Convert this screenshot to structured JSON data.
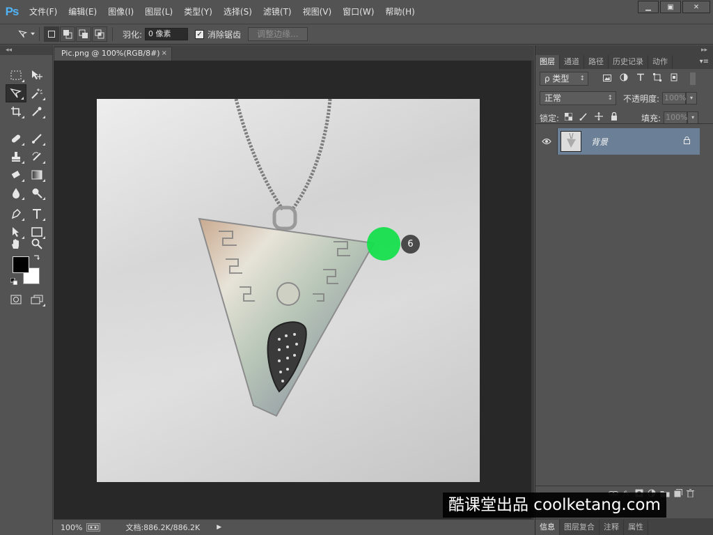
{
  "app": {
    "logo": "Ps",
    "menus": [
      "文件(F)",
      "编辑(E)",
      "图像(I)",
      "图层(L)",
      "类型(Y)",
      "选择(S)",
      "滤镜(T)",
      "视图(V)",
      "窗口(W)",
      "帮助(H)"
    ],
    "window_controls": {
      "minimize": "▁",
      "maximize": "▣",
      "close": "✕"
    }
  },
  "options": {
    "feather_label": "羽化:",
    "feather_value": "0 像素",
    "antialias_checked": "✓",
    "antialias_label": "消除锯齿",
    "refine_edge_label": "调整边缘..."
  },
  "toolbox": {
    "collapse": "◂◂"
  },
  "document": {
    "tab_title": "Pic.png @ 100%(RGB/8#)",
    "tab_close": "×"
  },
  "status": {
    "zoom": "100%",
    "doc_size": "文档:886.2K/886.2K",
    "arrow": "▶"
  },
  "panels": {
    "collapse": "▸▸",
    "top_tabs": [
      "图层",
      "通道",
      "路径",
      "历史记录",
      "动作"
    ],
    "menu_icon": "▾≡",
    "filter_type": "ρ 类型",
    "blend_mode": "正常",
    "opacity_label": "不透明度:",
    "opacity_value": "100%",
    "lock_label": "锁定:",
    "fill_label": "填充:",
    "fill_value": "100%",
    "layer": {
      "name": "背景"
    },
    "bottom_tabs": [
      "信息",
      "图层复合",
      "注释",
      "属性"
    ]
  },
  "watermark": "酷课堂出品 coolketang.com",
  "marker": {
    "number": "6",
    "color": "#13e04a"
  },
  "colors": {
    "foreground": "#000000",
    "background": "#ffffff",
    "layer_selected": "#6b8096",
    "ps_logo": "#4fb3f6"
  }
}
